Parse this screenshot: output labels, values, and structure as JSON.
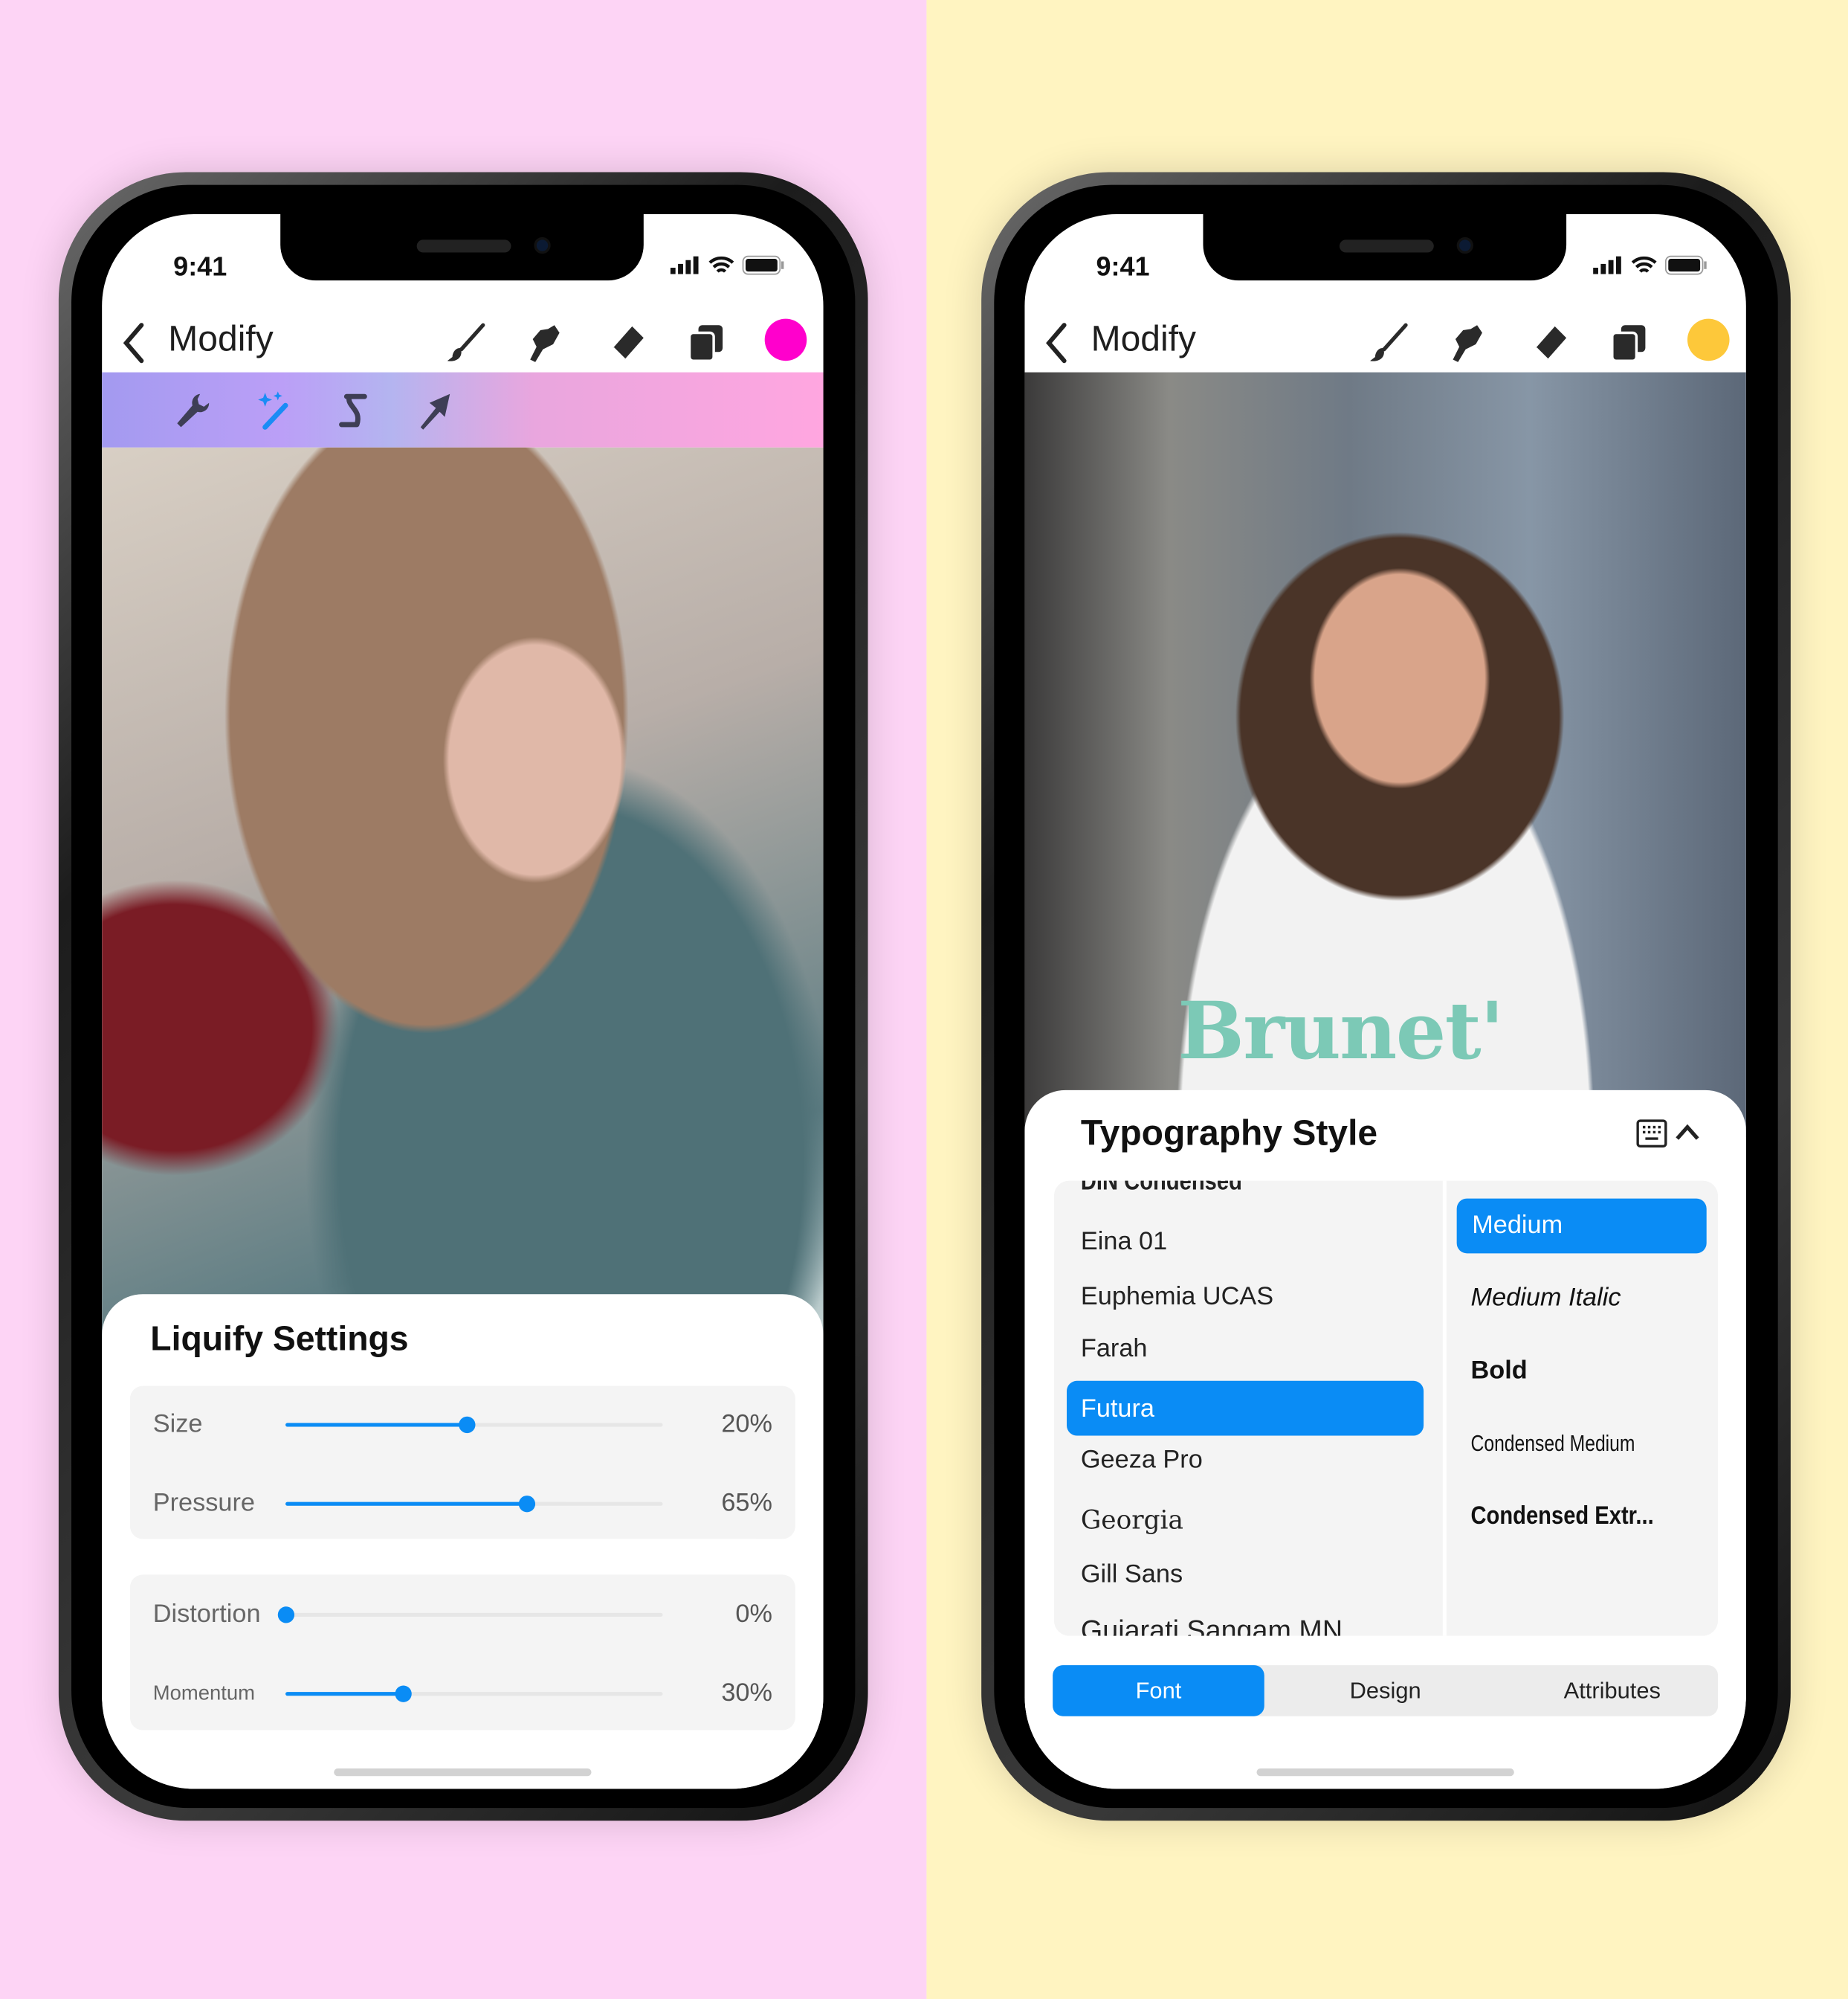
{
  "colors": {
    "left_bg": "#fdd4f5",
    "right_bg": "#fff4c1",
    "accent": "#0a8cf5",
    "left_swatch": "#ff00cc",
    "right_swatch": "#fdc83a"
  },
  "left_phone": {
    "status": {
      "time": "9:41"
    },
    "nav": {
      "back_icon": "chevron-left-icon",
      "title": "Modify",
      "tools": [
        "brush-icon",
        "smudge-icon",
        "eraser-icon",
        "layers-icon"
      ]
    },
    "subtoolbar": {
      "tools": [
        "wrench-icon",
        "magic-wand-icon",
        "liquify-icon",
        "arrow-icon"
      ],
      "active": "magic-wand-icon"
    },
    "sheet": {
      "title": "Liquify Settings",
      "sliders": [
        {
          "label": "Size",
          "value": "20%",
          "level": 0.48
        },
        {
          "label": "Pressure",
          "value": "65%",
          "level": 0.64
        },
        {
          "label": "Distortion",
          "value": "0%",
          "level": 0
        },
        {
          "label": "Momentum",
          "value": "30%",
          "level": 0.31
        }
      ]
    }
  },
  "right_phone": {
    "status": {
      "time": "9:41"
    },
    "nav": {
      "back_icon": "chevron-left-icon",
      "title": "Modify",
      "tools": [
        "brush-icon",
        "smudge-icon",
        "eraser-icon",
        "layers-icon"
      ]
    },
    "photo_text": "Brunet'",
    "sheet": {
      "title": "Typography Style",
      "fonts": [
        "DIN Condensed",
        "Eina 01",
        "Euphemia  UCAS",
        "Farah",
        "Futura",
        "Geeza Pro",
        "Georgia",
        "Gill Sans",
        "Gujarati Sangam MN"
      ],
      "selected_font": "Futura",
      "styles": [
        "Medium",
        "Medium Italic",
        "Bold",
        "Condensed Medium",
        "Condensed Extr..."
      ],
      "selected_style": "Medium",
      "tabs": [
        "Font",
        "Design",
        "Attributes"
      ],
      "active_tab": "Font"
    }
  }
}
